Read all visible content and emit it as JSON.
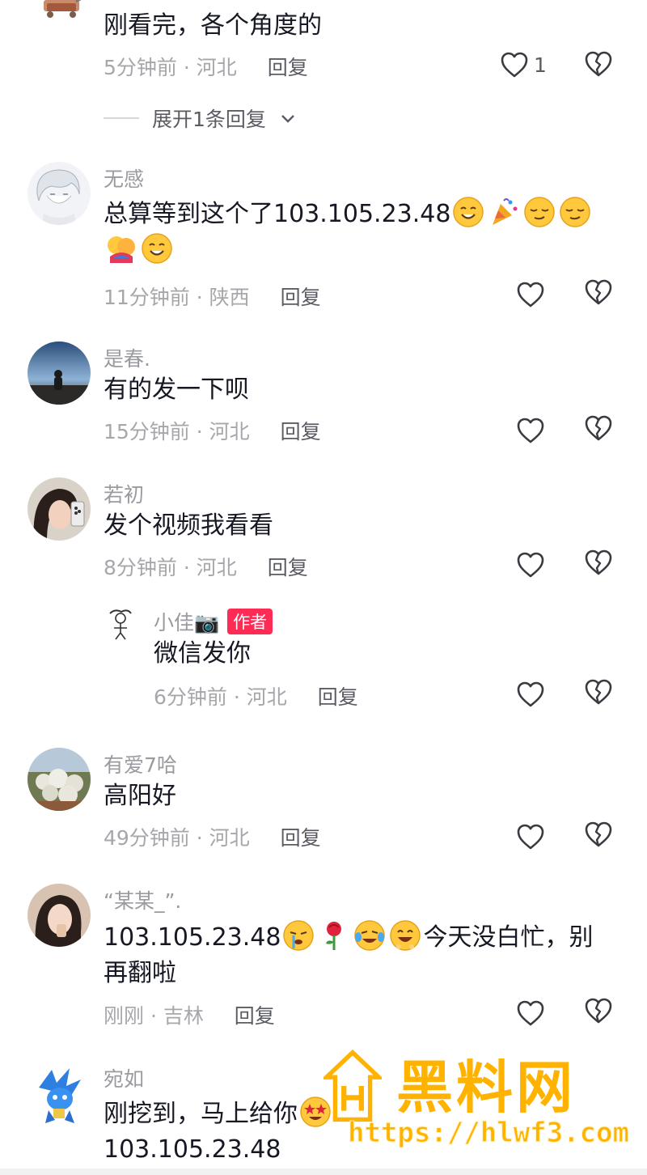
{
  "comments": [
    {
      "author": "",
      "text": "刚看完，各个角度的",
      "time": "5分钟前 · 河北",
      "reply_label": "回复",
      "likes": "1",
      "expand_label": "展开1条回复"
    },
    {
      "author": "无感",
      "text": "总算等到这个了103.105.23.48",
      "time": "11分钟前 · 陕西",
      "reply_label": "回复",
      "likes": ""
    },
    {
      "author": "是春.",
      "text": "有的发一下呗",
      "time": "15分钟前 · 河北",
      "reply_label": "回复",
      "likes": ""
    },
    {
      "author": "若初",
      "text": "发个视频我看看",
      "time": "8分钟前 · 河北",
      "reply_label": "回复",
      "likes": ""
    },
    {
      "author": "小佳📷",
      "badge": "作者",
      "text": "微信发你",
      "time": "6分钟前 · 河北",
      "reply_label": "回复",
      "likes": ""
    },
    {
      "author": "有爱7哈",
      "text": "高阳好",
      "time": "49分钟前 · 河北",
      "reply_label": "回复",
      "likes": ""
    },
    {
      "author": "“某某_”.",
      "text_a": "103.105.23.48",
      "text_b": "今天没白忙，别再翻啦",
      "time": "刚刚 · 吉林",
      "reply_label": "回复",
      "likes": ""
    },
    {
      "author": "宛如",
      "text_a": "刚挖到，马上给你",
      "text_b": "103.105.23.48"
    }
  ],
  "watermark": {
    "title": "黑料网",
    "url": "https://hlwf3.com"
  },
  "colors": {
    "primary_text": "#161823",
    "secondary_text": "#9a9ba0",
    "badge": "#fe2c55",
    "watermark": "#ffb300"
  },
  "icons": {
    "like": "heart-outline-icon",
    "dislike": "broken-heart-icon",
    "expand": "chevron-down-icon"
  }
}
